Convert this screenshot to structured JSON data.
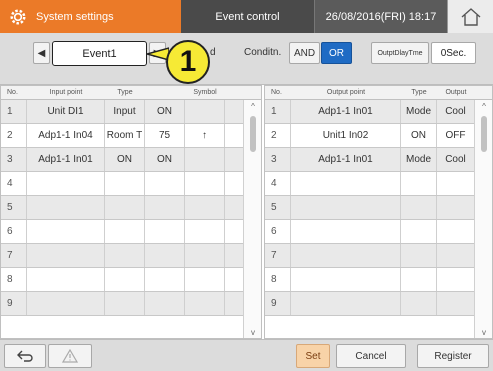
{
  "header": {
    "system_title": "System settings",
    "event_control": "Event control",
    "datetime": "26/08/2016(FRI) 18:17"
  },
  "toolbar": {
    "event_name": "Event1",
    "callout_number": "1",
    "peek_text": "d",
    "condition_label": "Conditn.",
    "and_label": "AND",
    "or_label": "OR",
    "selected_condition": "OR",
    "output_delay_label": "OutptDlayTme",
    "output_delay_value": "0Sec."
  },
  "input_table": {
    "headers": {
      "no": "No.",
      "point": "Input point",
      "type": "Type",
      "setting": "",
      "symbol": "Symbol"
    },
    "rows": [
      {
        "no": "1",
        "point": "Unit DI1",
        "type": "Input",
        "setting": "ON",
        "symbol": ""
      },
      {
        "no": "2",
        "point": "Adp1-1 In04",
        "type": "Room T",
        "setting": "75",
        "symbol": "↑"
      },
      {
        "no": "3",
        "point": "Adp1-1 In01",
        "type": "ON",
        "setting": "ON",
        "symbol": ""
      },
      {
        "no": "4",
        "point": "",
        "type": "",
        "setting": "",
        "symbol": ""
      },
      {
        "no": "5",
        "point": "",
        "type": "",
        "setting": "",
        "symbol": ""
      },
      {
        "no": "6",
        "point": "",
        "type": "",
        "setting": "",
        "symbol": ""
      },
      {
        "no": "7",
        "point": "",
        "type": "",
        "setting": "",
        "symbol": ""
      },
      {
        "no": "8",
        "point": "",
        "type": "",
        "setting": "",
        "symbol": ""
      },
      {
        "no": "9",
        "point": "",
        "type": "",
        "setting": "",
        "symbol": ""
      }
    ]
  },
  "output_table": {
    "headers": {
      "no": "No.",
      "point": "Output point",
      "type": "Type",
      "output": "Output"
    },
    "rows": [
      {
        "no": "1",
        "point": "Adp1-1 In01",
        "type": "Mode",
        "output": "Cool"
      },
      {
        "no": "2",
        "point": "Unit1 In02",
        "type": "ON",
        "output": "OFF"
      },
      {
        "no": "3",
        "point": "Adp1-1 In01",
        "type": "Mode",
        "output": "Cool"
      },
      {
        "no": "4",
        "point": "",
        "type": "",
        "output": ""
      },
      {
        "no": "5",
        "point": "",
        "type": "",
        "output": ""
      },
      {
        "no": "6",
        "point": "",
        "type": "",
        "output": ""
      },
      {
        "no": "7",
        "point": "",
        "type": "",
        "output": ""
      },
      {
        "no": "8",
        "point": "",
        "type": "",
        "output": ""
      },
      {
        "no": "9",
        "point": "",
        "type": "",
        "output": ""
      }
    ]
  },
  "footer": {
    "set_label": "Set",
    "cancel_label": "Cancel",
    "register_label": "Register"
  },
  "colors": {
    "accent_orange": "#eb7a28",
    "header_dark": "#4a4a4a",
    "selected_blue": "#1f6bc4",
    "callout_yellow": "#f6ea35"
  },
  "icons": [
    "gear-icon",
    "home-icon",
    "chevron-left-icon",
    "chevron-right-icon",
    "back-arrow-icon",
    "warning-icon",
    "scroll-up-icon",
    "scroll-down-icon"
  ]
}
